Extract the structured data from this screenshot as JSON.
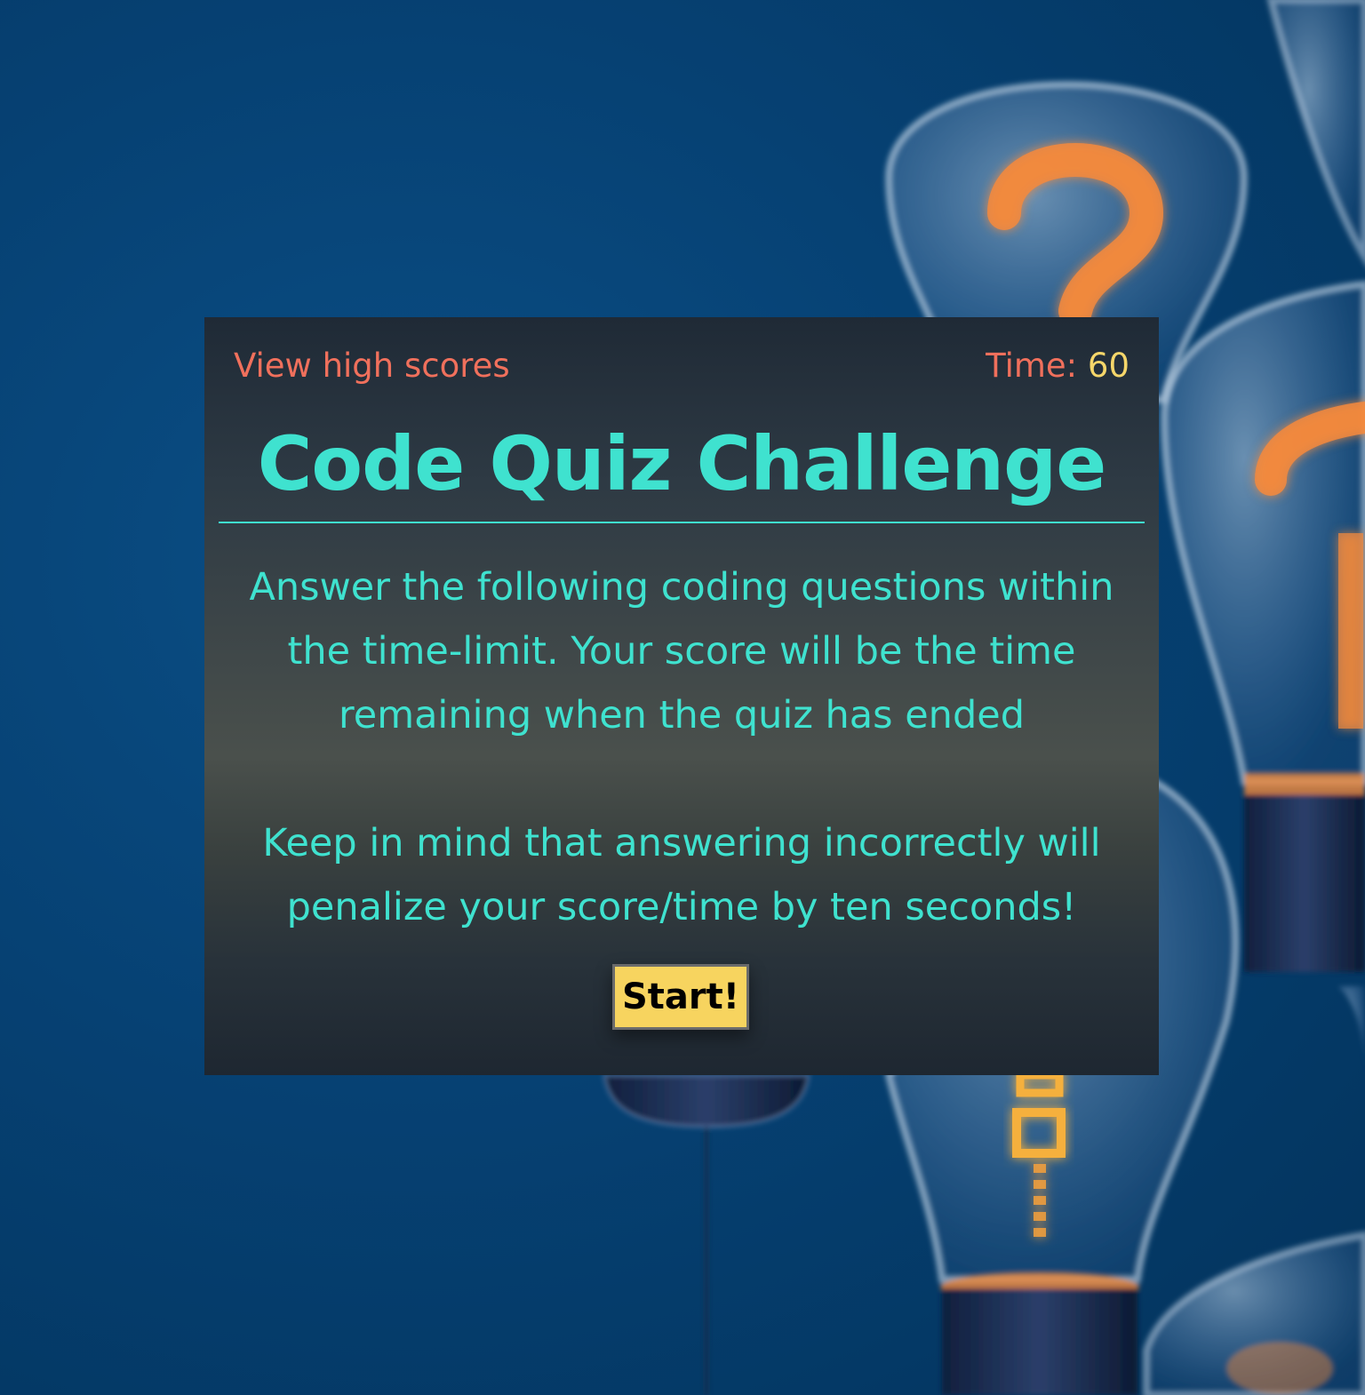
{
  "header": {
    "high_scores_link": "View high scores",
    "timer_label": "Time: ",
    "timer_value": "60"
  },
  "main": {
    "title": "Code Quiz Challenge",
    "instructions_1": "Answer the following coding questions within the time-limit. Your score will be the time remaining when the quiz has ended",
    "instructions_2": "Keep in mind that answering incorrectly will penalize your score/time by ten seconds!",
    "start_button": "Start!"
  },
  "theme": {
    "background": "#064173",
    "accent_teal": "#3fe2cf",
    "accent_coral": "#f0705c",
    "accent_yellow": "#f5d66a",
    "button_bg": "#f7d45f"
  },
  "background_art": {
    "icons": [
      "lightbulb-icon",
      "question-mark-icon"
    ]
  }
}
